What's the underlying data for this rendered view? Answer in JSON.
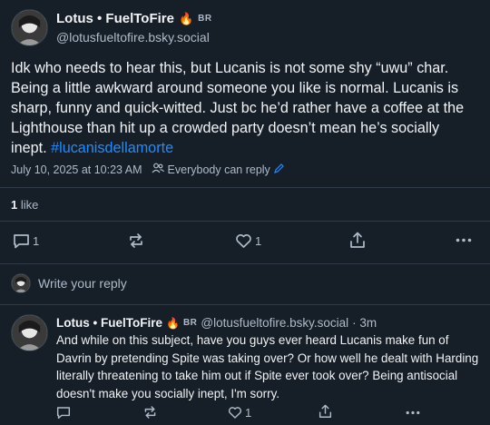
{
  "post": {
    "author_name": "Lotus • FuelToFire",
    "author_badge": "BR",
    "author_handle": "@lotusfueltofire.bsky.social",
    "text_main": "Idk who needs to hear this, but Lucanis is not some shy “uwu” char. Being a little awkward around someone you like is normal. Lucanis is sharp, funny and quick-witted. Just bc he’d rather have a coffee at the Lighthouse than hit up a crowded party doesn’t mean he’s socially inept. ",
    "hashtag": "#lucanisdellamorte",
    "timestamp": "July 10, 2025 at 10:23 AM",
    "reply_setting": "Everybody can reply",
    "likes_count": "1",
    "likes_label": "like",
    "actions": {
      "reply_count": "1",
      "like_count": "1"
    }
  },
  "composer": {
    "placeholder": "Write your reply"
  },
  "reply": {
    "author_name": "Lotus • FuelToFire",
    "author_badge": "BR",
    "author_handle": "@lotusfueltofire.bsky.social",
    "age": "· 3m",
    "text": "And while on this subject, have you guys ever heard Lucanis make fun of Davrin by pretending Spite was taking over? Or how well he dealt with Harding literally threatening to take him out if Spite ever took over? Being antisocial doesn't make you socially inept, I'm sorry.",
    "actions": {
      "like_count": "1"
    }
  },
  "colors": {
    "background": "#161e27",
    "text": "#f1f3f5",
    "muted": "#aebbc9",
    "accent": "#208bfe",
    "divider": "#2e3a47"
  }
}
